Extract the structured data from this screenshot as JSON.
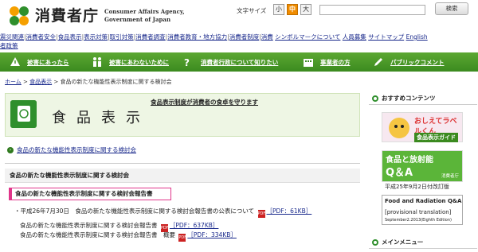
{
  "header": {
    "logo_text": "消費者庁",
    "agency_en_line1": "Consumer Affairs Agency,",
    "agency_en_line2": "Government of Japan",
    "font_size_label": "文字サイズ",
    "font_sizes": [
      "小",
      "中",
      "大"
    ],
    "search_placeholder": "",
    "search_button": "検索"
  },
  "toplinks": [
    "震災関連",
    "消費者安全",
    "食品表示",
    "表示対策",
    "取引対策",
    "消費者調査",
    "消費者教育・地方協力",
    "消費者制度",
    "消費",
    "シンボルマークについて",
    "人員募集",
    "サイトマップ",
    "English",
    "者政策"
  ],
  "greennav": [
    {
      "label": "被害にあったら",
      "icon": "warning-icon"
    },
    {
      "label": "被害にあわないために",
      "icon": "people-icon"
    },
    {
      "label": "消費者行政について知りたい",
      "icon": "question-icon"
    },
    {
      "label": "事業者の方",
      "icon": "building-icon"
    },
    {
      "label": "パブリックコメント",
      "icon": "pen-icon"
    }
  ],
  "breadcrumb": {
    "home": "ホーム",
    "section": "食品表示",
    "current": "食品の新たな機能性表示制度に関する検討会"
  },
  "banner": {
    "title": "食品表示",
    "slogan": "食品表示制度が消費者の食卓を守ります"
  },
  "subnav_label": "食品の新たな機能性表示制度に関する検討会",
  "section_heading": "食品の新たな機能性表示制度に関する検討会",
  "report_title": "食品の新たな機能性表示制度に関する検討会報告書",
  "line1": {
    "text": "・平成26年7月30日　食品の新たな機能性表示制度に関する検討会報告書の公表について",
    "pdf": "［PDF：61KB］"
  },
  "line2": {
    "text": "食品の新たな機能性表示制度に関する検討会報告書",
    "pdf": "［PDF：637KB］"
  },
  "line3": {
    "text": "食品の新たな機能性表示制度に関する検討会報告書　概要",
    "pdf": "［PDF：334KB］"
  },
  "sidebar": {
    "recommended_heading": "おすすめコンテンツ",
    "main_menu_heading": "メインメニュー",
    "card1_title": "おしえてラベルくん",
    "card1_sub": "食品表示ガイド",
    "card2_title": "食品と放射能",
    "card2_sub": "Q＆A",
    "card2_org": "消費者庁",
    "card2_caption": "平成25年9月2日付改訂版",
    "card3_title": "Food and Radiation Q&A",
    "card3_sub": "[provisional translation]",
    "card3_date": "September2.2013(Eighth Edition)"
  },
  "colors": {
    "nav_green": "#4a9a28",
    "accent_pink": "#e0358a",
    "active_orange": "#f08c00"
  }
}
